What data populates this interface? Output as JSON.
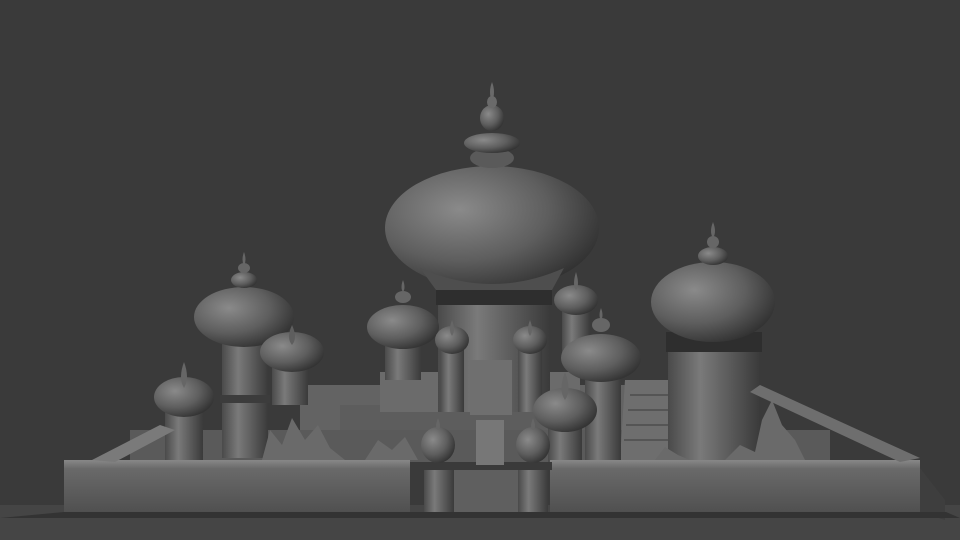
{
  "scene": {
    "subject": "palace-render",
    "colors": {
      "background": "#3a3a3a",
      "wall_light": "#7e7e7e",
      "wall_mid": "#606060",
      "wall_dark": "#4a4a4a",
      "shadow": "#222222"
    }
  }
}
